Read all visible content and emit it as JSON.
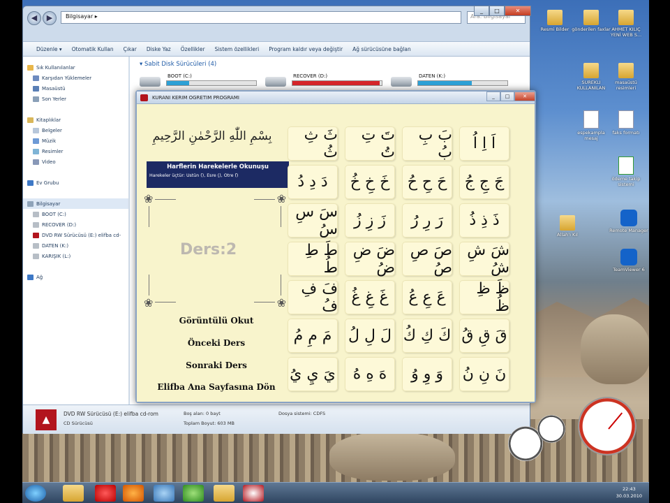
{
  "explorer": {
    "breadcrumb": "Bilgisayar ▸",
    "search_placeholder": "Ara: Bilgisayar",
    "toolbar": [
      "Düzenle ▾",
      "Otomatik Kullan",
      "Çıkar",
      "Diske Yaz",
      "Özellikler",
      "Sistem özellikleri",
      "Program kaldır veya değiştir",
      "Ağ sürücüsüne bağlan"
    ],
    "nav": [
      {
        "label": "Sık Kullanılanlar",
        "color": "#e8b64a"
      },
      {
        "label": "Karşıdan Yüklemeler",
        "color": "#6d8bbf"
      },
      {
        "label": "Masaüstü",
        "color": "#5a7fb6"
      },
      {
        "label": "Son Yerler",
        "color": "#8aa0b8"
      },
      {
        "label": "",
        "color": ""
      },
      {
        "label": "Kitaplıklar",
        "color": "#d9b75a"
      },
      {
        "label": "Belgeler",
        "color": "#b7c7db"
      },
      {
        "label": "Müzik",
        "color": "#6d9ad6"
      },
      {
        "label": "Resimler",
        "color": "#7fb4d6"
      },
      {
        "label": "Video",
        "color": "#8898b8"
      },
      {
        "label": "",
        "color": ""
      },
      {
        "label": "Ev Grubu",
        "color": "#3d78c6"
      },
      {
        "label": "",
        "color": ""
      },
      {
        "label": "Bilgisayar",
        "color": "#8ea3b9"
      },
      {
        "label": "BOOT (C:)",
        "color": "#b7bec6"
      },
      {
        "label": "RECOVER (D:)",
        "color": "#b7bec6"
      },
      {
        "label": "DVD RW Sürücüsü (E:) elifba cd-",
        "color": "#b2141d"
      },
      {
        "label": "DATEN (K:)",
        "color": "#b7bec6"
      },
      {
        "label": "KARIŞIK (L:)",
        "color": "#b7bec6"
      },
      {
        "label": "",
        "color": ""
      },
      {
        "label": "Ağ",
        "color": "#3d78c6"
      }
    ],
    "group_title": "▾ Sabit Disk Sürücüleri (4)",
    "drives": [
      {
        "label": "BOOT (C:)",
        "fill": 0.25,
        "color": "#2da2d8"
      },
      {
        "label": "RECOVER (D:)",
        "fill": 0.98,
        "color": "#d7262a"
      },
      {
        "label": "DATEN (K:)",
        "fill": 0.6,
        "color": "#2da2d8"
      }
    ],
    "details": {
      "name": "DVD RW Sürücüsü (E:) elifba cd-rom",
      "type": "CD Sürücüsü",
      "free_label": "Boş alan: 0 bayt",
      "total_label": "Toplam Boyut: 603 MB",
      "fs_label": "Dosya sistemi: CDFS"
    }
  },
  "app": {
    "title": "KURANI KERIM OGRETIM PROGRAMI",
    "bismillah": "بِسْمِ اللّٰهِ الرَّحْمٰنِ الرَّحِيمِ",
    "lesson_title": "Harflerin Harekelerle Okunuşu",
    "lesson_sub": "Harekeler üçtür: Üstün (َ), Esre (ِ), Ötre (ُ)",
    "lesson_label": "Ders:2",
    "menu": [
      "Görüntülü Okut",
      "Önceki Ders",
      "Sonraki Ders",
      "Elifba Ana Sayfasına Dön"
    ],
    "cells": [
      "ثَ ثِ ثُ",
      "تَ تِ تُ",
      "بَ بِ بُ",
      "اَ اِ اُ",
      "دَ دِ دُ",
      "خَ خِ خُ",
      "حَ حِ حُ",
      "جَ جِ جُ",
      "سَ سِ سُ",
      "زَ زِ زُ",
      "رَ رِ رُ",
      "ذَ ذِ ذُ",
      "طَ طِ طُ",
      "ضَ ضِ ضُ",
      "صَ صِ صُ",
      "شَ شِ شُ",
      "فَ فِ فُ",
      "غَ غِ غُ",
      "عَ عِ عُ",
      "ظَ ظِ ظُ",
      "مَ مِ مُ",
      "لَ لِ لُ",
      "كَ كِ كُ",
      "قَ قِ قُ",
      "يَ يِ يُ",
      "هَ هِ هُ",
      "وَ وِ وُ",
      "نَ نِ نُ"
    ]
  },
  "desktop": [
    {
      "label": "Resmi Bilder",
      "kind": "folder"
    },
    {
      "label": "gönderilen faxlar",
      "kind": "folder"
    },
    {
      "label": "AHMET KILIÇ YENİ WEB S...",
      "kind": "folder"
    },
    {
      "label": "SUREKLI KULLANILAN",
      "kind": "folder"
    },
    {
      "label": "masaüstü resimleri",
      "kind": "folder"
    },
    {
      "label": "espekampla mesaj",
      "kind": "doc"
    },
    {
      "label": "faks formatı",
      "kind": "doc"
    },
    {
      "label": "ödeme takip sistemi",
      "kind": "xls"
    },
    {
      "label": "Allah'ı Kıl",
      "kind": "folder"
    },
    {
      "label": "Remote Manager",
      "kind": "tv"
    },
    {
      "label": "TeamViewer 6",
      "kind": "tv"
    }
  ],
  "taskbar": {
    "time": "22:43",
    "date": "30.03.2010"
  }
}
